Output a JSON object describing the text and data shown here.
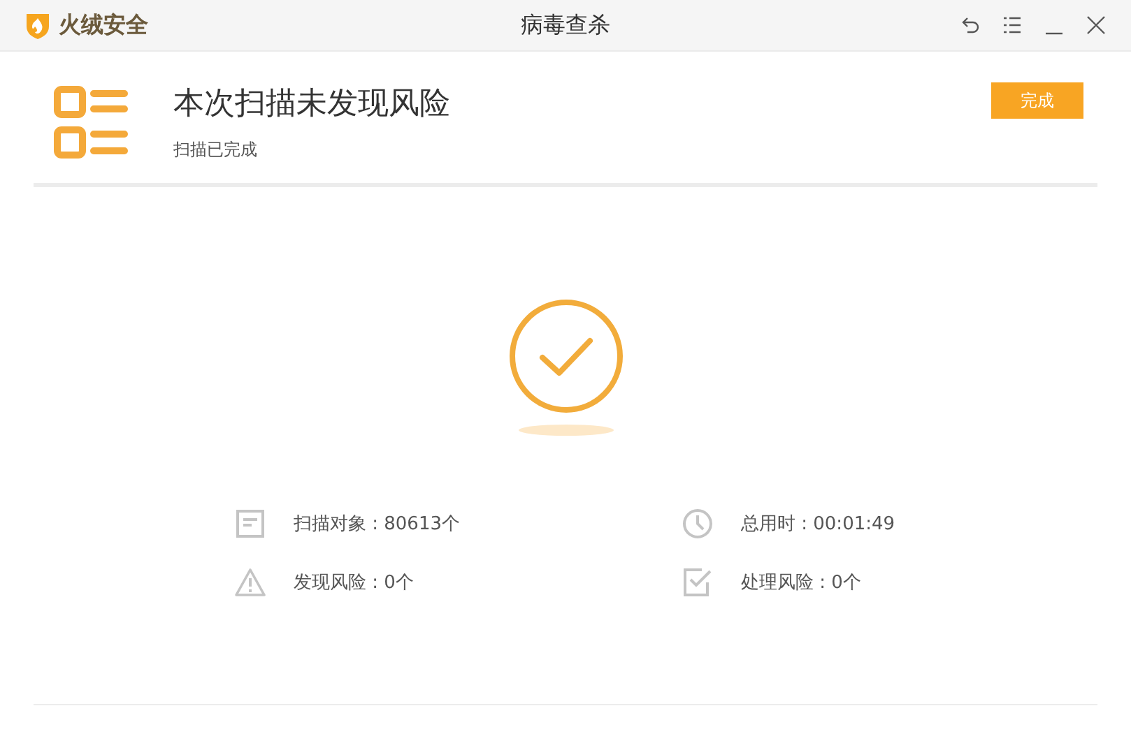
{
  "window": {
    "app_name": "火绒安全",
    "title": "病毒查杀"
  },
  "header": {
    "title": "本次扫描未发现风险",
    "subtitle": "扫描已完成",
    "button": "完成"
  },
  "stats": [
    {
      "kind": "document",
      "label": "扫描对象 : 80613个"
    },
    {
      "kind": "clock",
      "label": "总用时 : 00:01:49"
    },
    {
      "kind": "warning",
      "label": "发现风险 : 0个"
    },
    {
      "kind": "checkbox",
      "label": "处理风险 : 0个"
    }
  ]
}
